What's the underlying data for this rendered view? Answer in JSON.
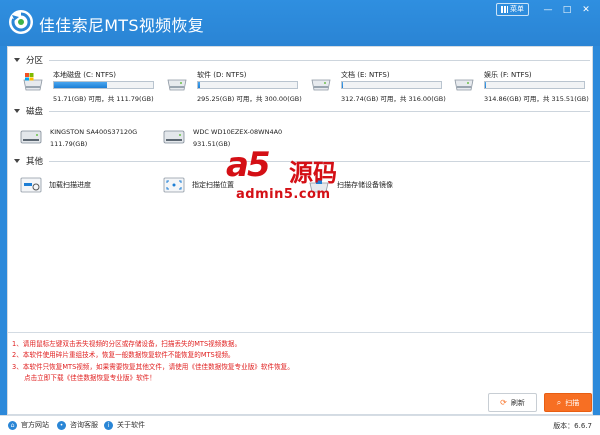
{
  "app": {
    "title": "佳佳索尼MTS视频恢复",
    "menu_label": "菜单",
    "minimize_glyph": "—",
    "maximize_glyph": "□",
    "close_glyph": "✕"
  },
  "sections": {
    "partitions_label": "分区",
    "disks_label": "磁盘",
    "other_label": "其他"
  },
  "partitions": [
    {
      "name": "本地磁盘 (C: NTFS)",
      "capacity": "51.71(GB) 可用，共 111.79(GB)",
      "used_fraction": 0.54,
      "icon": "windows-drive-icon"
    },
    {
      "name": "软件 (D: NTFS)",
      "capacity": "295.25(GB) 可用，共 300.00(GB)",
      "used_fraction": 0.02,
      "icon": "drive-icon"
    },
    {
      "name": "文档 (E: NTFS)",
      "capacity": "312.74(GB) 可用，共 316.00(GB)",
      "used_fraction": 0.01,
      "icon": "drive-icon"
    },
    {
      "name": "娱乐 (F: NTFS)",
      "capacity": "314.86(GB) 可用，共 315.51(GB)",
      "used_fraction": 0.01,
      "icon": "drive-icon"
    }
  ],
  "disks": [
    {
      "name": "KINGSTON SA400S37120G",
      "capacity": "111.79(GB)",
      "icon": "hard-disk-icon"
    },
    {
      "name": "WDC WD10EZEX-08WN4A0",
      "capacity": "931.51(GB)",
      "icon": "hard-disk-icon"
    }
  ],
  "tools": [
    {
      "name": "加载扫描进度",
      "icon": "load-progress-icon"
    },
    {
      "name": "指定扫描位置",
      "icon": "target-location-icon"
    },
    {
      "name": "扫描存储设备镜像",
      "icon": "device-image-icon"
    }
  ],
  "watermark": {
    "brand": "a5",
    "brand_cn": "源码",
    "url": "admin5.com"
  },
  "notes": [
    "1、请用鼠标左键双击丢失视频的分区或存储设备，扫描丢失的MTS视频数据。",
    "2、本软件使用碎片重组技术，恢复一般数据恢复软件不能恢复的MTS视频。",
    "3、本软件只恢复MTS视频，如果需要恢复其他文件，请使用《佳佳数据恢复专业版》软件恢复。",
    "点击立即下载《佳佳数据恢复专业版》软件！"
  ],
  "buttons": {
    "refresh_label": "刷新",
    "scan_label": "扫描"
  },
  "status": {
    "website": "官方网站",
    "support": "咨询客服",
    "about": "关于软件",
    "version": "版本：6.6.7"
  },
  "colors": {
    "titlebar": "#2c89da",
    "accent": "#1d7fd6",
    "scan_button": "#f76f23",
    "note_text": "#e02020",
    "watermark": "#d40f15"
  }
}
